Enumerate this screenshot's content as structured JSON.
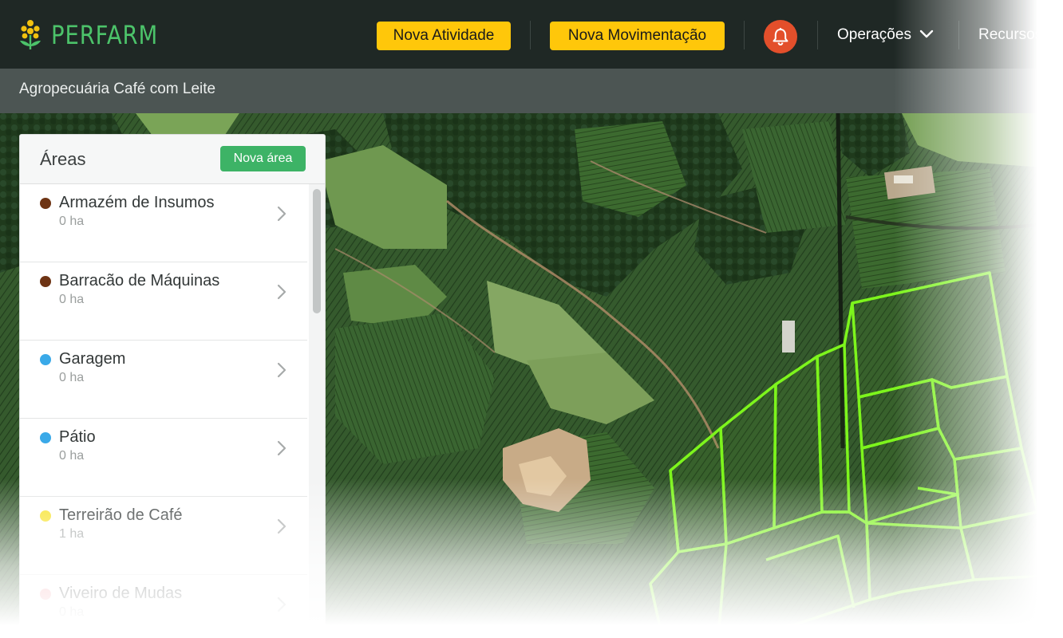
{
  "brand": {
    "name": "PERFARM",
    "color": "#4cc36a"
  },
  "header": {
    "new_activity": "Nova Atividade",
    "new_movement": "Nova Movimentação",
    "operations": "Operações",
    "resources": "Recursos"
  },
  "farm": {
    "name": "Agropecuária Café com Leite"
  },
  "areas": {
    "title": "Áreas",
    "new_area": "Nova área",
    "items": [
      {
        "name": "Armazém de Insumos",
        "size": "0 ha",
        "color": "#6e3414"
      },
      {
        "name": "Barracão de Máquinas",
        "size": "0 ha",
        "color": "#6e3414"
      },
      {
        "name": "Garagem",
        "size": "0 ha",
        "color": "#3aa9e8"
      },
      {
        "name": "Pátio",
        "size": "0 ha",
        "color": "#3aa9e8"
      },
      {
        "name": "Terreirão de Café",
        "size": "1 ha",
        "color": "#f7e22a"
      },
      {
        "name": "Viveiro de Mudas",
        "size": "0 ha",
        "color": "#f29aa1"
      }
    ]
  },
  "colors": {
    "accent_yellow": "#ffc70a",
    "accent_green": "#3db366",
    "alert_red": "#e34f2b",
    "plot_outline": "#7df51c"
  }
}
